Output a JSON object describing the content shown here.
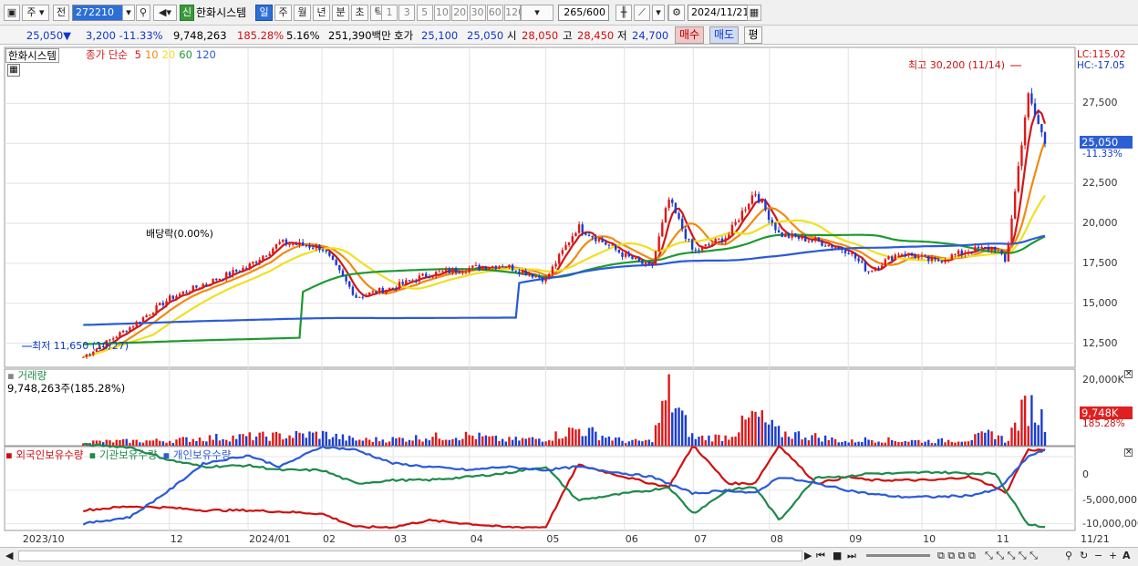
{
  "toolbar": {
    "period_unit": "주",
    "prev_label": "전",
    "stock_code": "272210",
    "new_badge": "신",
    "stock_name": "한화시스템",
    "interval_buttons": [
      "일",
      "주",
      "월",
      "년",
      "분",
      "초",
      "틱"
    ],
    "minute_buttons": [
      "1",
      "3",
      "5",
      "10",
      "20",
      "30",
      "60",
      "120"
    ],
    "count_value": "265",
    "count_total": "/600",
    "date_value": "2024/11/21"
  },
  "quote": {
    "price": "25,050",
    "arrow": "▼",
    "change": "3,200",
    "change_pct": "-11.33%",
    "volume": "9,748,263",
    "volume_ratio": "185.28%",
    "turnover_pct": "5.16%",
    "trade_value": "251,390백만",
    "bid_label": "호가",
    "bid1": "25,100",
    "bid2": "25,050",
    "open_label": "시",
    "open": "28,050",
    "high_label": "고",
    "high": "28,450",
    "low_label": "저",
    "low": "24,700",
    "buy_label": "매수",
    "sell_label": "매도",
    "avg_label": "평"
  },
  "price_panel": {
    "name_tag": "한화시스템",
    "legend_prefix": "종가 단순",
    "ma_periods": [
      "5",
      "10",
      "20",
      "60",
      "120"
    ],
    "ma_colors": [
      "#d01818",
      "#f08a10",
      "#f0e020",
      "#1e9a30",
      "#2a5ad8"
    ],
    "lc_label": "LC:115.02",
    "hc_label": "HC:-17.05",
    "y_ticks": [
      "27,500",
      "25,000",
      "22,500",
      "20,000",
      "17,500",
      "15,000",
      "12,500"
    ],
    "current_price_tag": "25,050",
    "current_pct": "-11.33%",
    "high_annotation": "최고 30,200 (11/14)",
    "low_annotation": "최저 11,650 (10/27)",
    "dividend_annotation": "배당락(0.00%)"
  },
  "volume_panel": {
    "title": "거래량",
    "value_label": "9,748,263주(185.28%)",
    "y_tick": "20,000K",
    "current_tag": "9,748K",
    "current_pct": "185.28%"
  },
  "holding_panel": {
    "series": [
      "외국인보유수량",
      "기관보유수량",
      "개인보유수량"
    ],
    "series_colors": [
      "#d01010",
      "#1e8a4a",
      "#2a5ad8"
    ],
    "y_ticks": [
      "0",
      "-5,000,000",
      "-10,000,000"
    ]
  },
  "x_axis": {
    "labels": [
      "2023/10",
      "12",
      "2024/01",
      "02",
      "03",
      "04",
      "05",
      "06",
      "07",
      "08",
      "09",
      "10",
      "11",
      "11/21"
    ]
  },
  "chart_data": {
    "type": "line",
    "title": "",
    "xlabel": "",
    "ylabel": "",
    "x": [
      "2023/10/27",
      "2023/11/15",
      "2023/12/01",
      "2023/12/15",
      "2024/01/02",
      "2024/01/15",
      "2024/02/01",
      "2024/02/15",
      "2024/03/01",
      "2024/03/15",
      "2024/04/01",
      "2024/04/15",
      "2024/05/02",
      "2024/05/15",
      "2024/06/03",
      "2024/06/14",
      "2024/06/21",
      "2024/07/01",
      "2024/07/15",
      "2024/07/26",
      "2024/08/05",
      "2024/08/20",
      "2024/09/02",
      "2024/09/10",
      "2024/09/23",
      "2024/10/07",
      "2024/10/21",
      "2024/11/01",
      "2024/11/05",
      "2024/11/14",
      "2024/11/21"
    ],
    "ylim": [
      11000,
      31000
    ],
    "series": [
      {
        "name": "종가",
        "values": [
          11650,
          13500,
          15300,
          16200,
          17300,
          18800,
          18500,
          15400,
          16000,
          16800,
          17200,
          17400,
          16500,
          19800,
          18000,
          17200,
          21500,
          18200,
          19200,
          22000,
          19300,
          18900,
          18300,
          17000,
          18200,
          17600,
          18300,
          18500,
          17500,
          28000,
          25050
        ]
      }
    ],
    "volume": {
      "unit": "K",
      "ylim": [
        0,
        20000
      ],
      "values": [
        1500,
        1800,
        2000,
        3000,
        3500,
        3800,
        4500,
        2200,
        2500,
        3300,
        4000,
        2200,
        2800,
        6500,
        1700,
        1800,
        20000,
        3000,
        3500,
        11500,
        5000,
        3500,
        1500,
        2500,
        2000,
        1800,
        2500,
        5000,
        1500,
        16000,
        9748
      ]
    },
    "holdings": {
      "ylim": [
        -11000000,
        1500000
      ],
      "foreign": [
        -8000000,
        -7400000,
        -7600000,
        -8000000,
        -8000000,
        -8200000,
        -8500000,
        -10500000,
        -10500000,
        -9500000,
        -10000000,
        -10500000,
        -10500000,
        -1200000,
        -3000000,
        -4000000,
        -4500000,
        1700000,
        -4000000,
        -4000000,
        1700000,
        -4000000,
        -3000000,
        -3500000,
        -3500000,
        -3500000,
        -3000000,
        -4500000,
        -5500000,
        1000000,
        1000000
      ],
      "institution": [
        1800000,
        1400000,
        -500000,
        -1500000,
        -1300000,
        -2000000,
        -2000000,
        -4000000,
        -3500000,
        -3500000,
        -3000000,
        -2500000,
        -1500000,
        -6500000,
        -5500000,
        -5000000,
        -4500000,
        -8500000,
        -5000000,
        -4500000,
        -9500000,
        -3000000,
        -3000000,
        -2500000,
        -2500000,
        -2300000,
        -2500000,
        -2500000,
        -5000000,
        -10000000,
        -10500000
      ],
      "individual": [
        -10000000,
        -9000000,
        -5000000,
        -1000000,
        200000,
        -1500000,
        1500000,
        1000000,
        -1000000,
        -1500000,
        -2000000,
        -1500000,
        -2000000,
        -1500000,
        -2500000,
        -3000000,
        -4000000,
        -5500000,
        -5000000,
        -5500000,
        -3000000,
        -4000000,
        -5000000,
        -5500000,
        -6000000,
        -6000000,
        -5800000,
        -5000000,
        -3800000,
        0,
        1000000
      ]
    }
  }
}
